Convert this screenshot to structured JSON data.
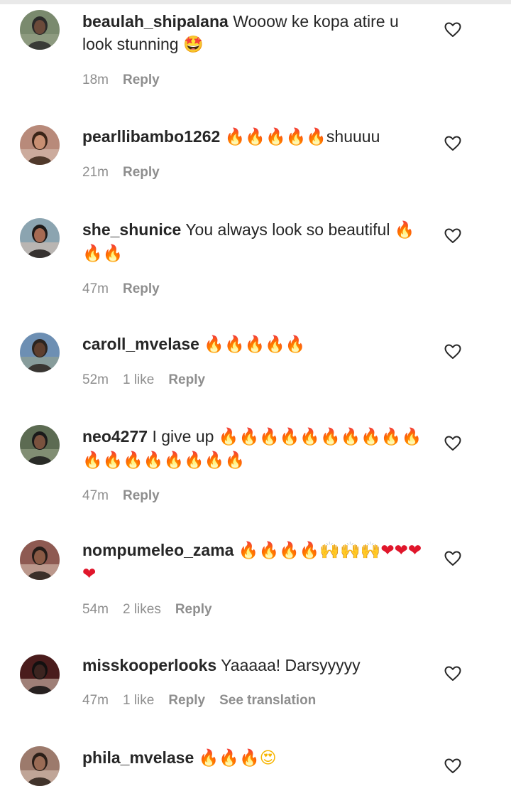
{
  "comments": [
    {
      "username": "beaulah_shipalana",
      "text": "Wooow ke kopa atire u look stunning",
      "emoji": "🤩",
      "time": "18m",
      "likes": "",
      "reply_label": "Reply",
      "translation_label": "",
      "avatar_color": "#7a8a6e",
      "avatar_icon": "person-outdoor-photo"
    },
    {
      "username": "pearllibambo1262",
      "text": "",
      "emoji": "🔥🔥🔥🔥🔥",
      "text_after": "shuuuu",
      "time": "21m",
      "likes": "",
      "reply_label": "Reply",
      "translation_label": "",
      "avatar_color": "#b88a7a",
      "avatar_icon": "person-portrait-photo"
    },
    {
      "username": "she_shunice",
      "text": "You always look so beautiful",
      "emoji": "🔥🔥🔥",
      "time": "47m",
      "likes": "",
      "reply_label": "Reply",
      "translation_label": "",
      "avatar_color": "#8ba4b0",
      "avatar_icon": "person-portrait-photo"
    },
    {
      "username": "caroll_mvelase",
      "text": "",
      "emoji": "🔥🔥🔥🔥🔥",
      "time": "52m",
      "likes": "1 like",
      "reply_label": "Reply",
      "translation_label": "",
      "avatar_color": "#6d8fb3",
      "avatar_icon": "person-outdoor-photo"
    },
    {
      "username": "neo4277",
      "text": "I give up",
      "emoji": "🔥🔥🔥🔥🔥🔥🔥🔥🔥🔥🔥🔥🔥🔥🔥🔥🔥🔥",
      "time": "47m",
      "likes": "",
      "reply_label": "Reply",
      "translation_label": "",
      "avatar_color": "#5c6b52",
      "avatar_icon": "person-outdoor-photo"
    },
    {
      "username": "nompumeleo_zama",
      "text": "",
      "emoji": "🔥🔥🔥🔥🙌🙌🙌❤️❤️❤️❤️",
      "time": "54m",
      "likes": "2 likes",
      "reply_label": "Reply",
      "translation_label": "",
      "avatar_color": "#8e5a52",
      "avatar_icon": "person-portrait-photo"
    },
    {
      "username": "misskooperlooks",
      "text": "Yaaaaa! Darsyyyyy",
      "emoji": "",
      "time": "47m",
      "likes": "1 like",
      "reply_label": "Reply",
      "translation_label": "See translation",
      "avatar_color": "#4a1c1c",
      "avatar_icon": "person-portrait-photo"
    },
    {
      "username": "phila_mvelase",
      "text": "",
      "emoji": "🔥🔥🔥😍",
      "time": "",
      "likes": "",
      "reply_label": "",
      "translation_label": "",
      "avatar_color": "#9c7a6c",
      "avatar_icon": "person-portrait-photo"
    }
  ],
  "like_icon": "heart-outline-icon"
}
